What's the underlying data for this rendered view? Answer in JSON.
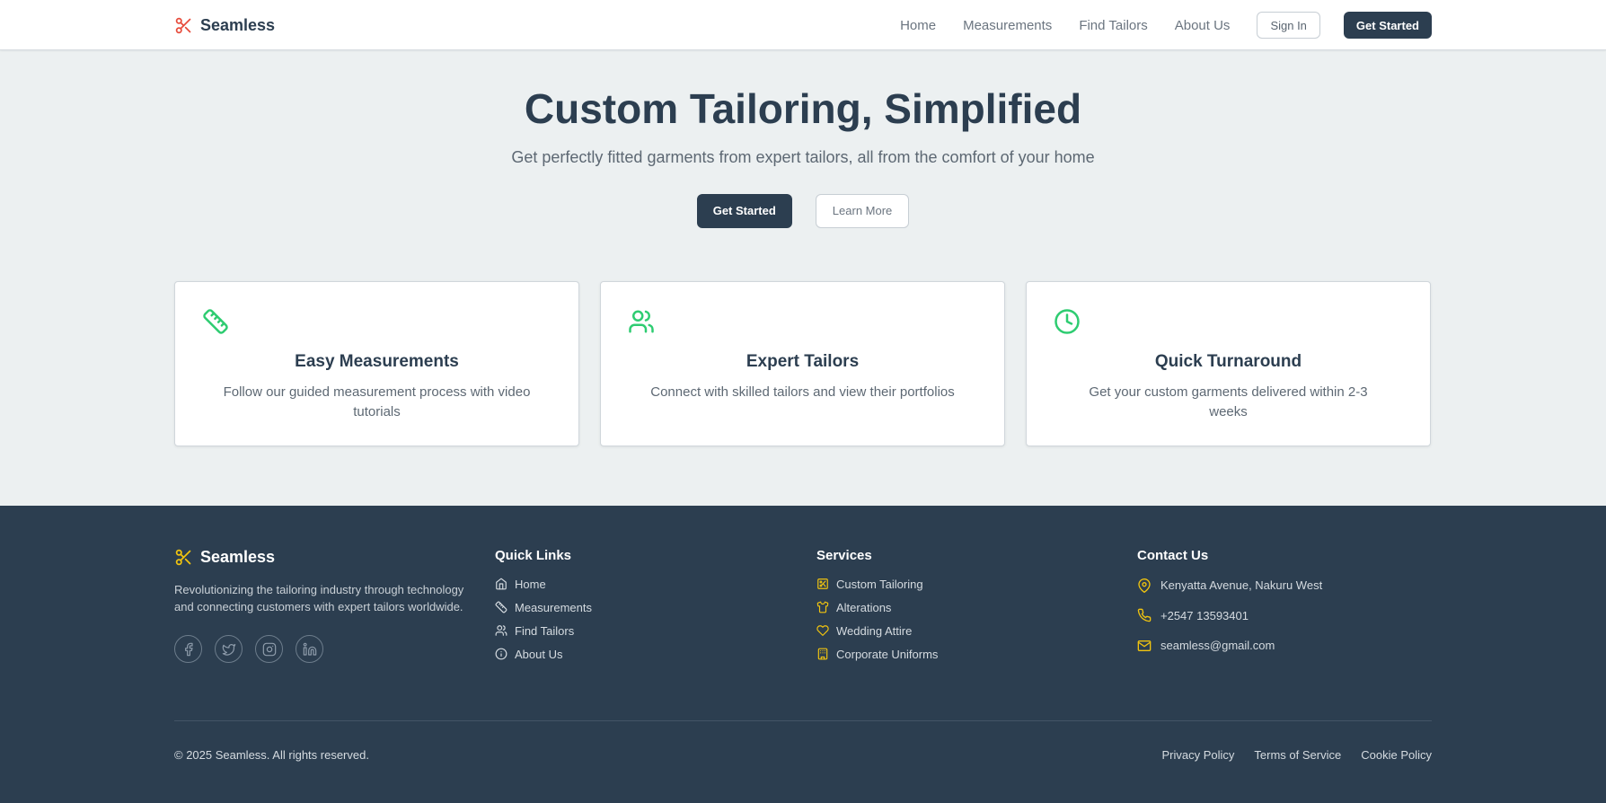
{
  "header": {
    "brand": "Seamless",
    "nav": [
      "Home",
      "Measurements",
      "Find Tailors",
      "About Us"
    ],
    "sign_in": "Sign In",
    "get_started": "Get Started"
  },
  "hero": {
    "title": "Custom Tailoring, Simplified",
    "subtitle": "Get perfectly fitted garments from expert tailors, all from the comfort of your home",
    "primary_button": "Get Started",
    "secondary_button": "Learn More"
  },
  "features": [
    {
      "icon": "ruler-icon",
      "title": "Easy Measurements",
      "text": "Follow our guided measurement process with video tutorials"
    },
    {
      "icon": "users-icon",
      "title": "Expert Tailors",
      "text": "Connect with skilled tailors and view their portfolios"
    },
    {
      "icon": "clock-icon",
      "title": "Quick Turnaround",
      "text": "Get your custom garments delivered within 2-3 weeks"
    }
  ],
  "footer": {
    "brand": "Seamless",
    "description": "Revolutionizing the tailoring industry through technology and connecting customers with expert tailors worldwide.",
    "socials": [
      "facebook-icon",
      "twitter-icon",
      "instagram-icon",
      "linkedin-icon"
    ],
    "quick_links": {
      "title": "Quick Links",
      "items": [
        "Home",
        "Measurements",
        "Find Tailors",
        "About Us"
      ]
    },
    "services": {
      "title": "Services",
      "items": [
        "Custom Tailoring",
        "Alterations",
        "Wedding Attire",
        "Corporate Uniforms"
      ]
    },
    "contact": {
      "title": "Contact Us",
      "address": "Kenyatta Avenue, Nakuru West",
      "phone": "+2547 13593401",
      "email": "seamless@gmail.com"
    },
    "copyright": "© 2025 Seamless. All rights reserved.",
    "legal": [
      "Privacy Policy",
      "Terms of Service",
      "Cookie Policy"
    ]
  },
  "colors": {
    "primary": "#2c3e50",
    "accent_red": "#e74c3c",
    "accent_green": "#2ecc71",
    "accent_gold": "#f1c40f",
    "background": "#ecf0f1"
  }
}
